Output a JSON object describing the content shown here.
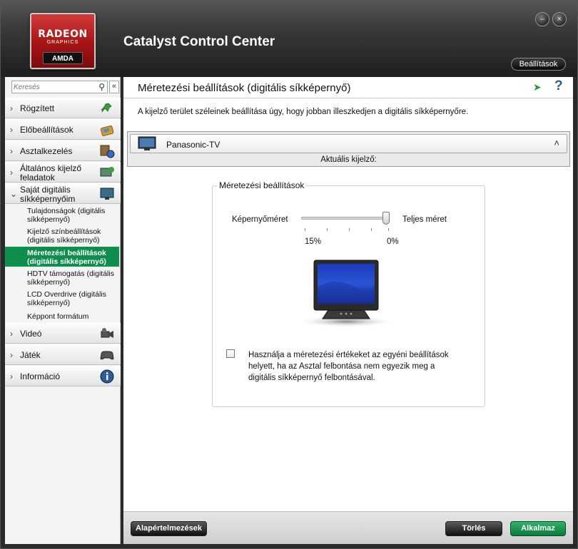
{
  "header": {
    "app_title": "Catalyst Control Center",
    "logo_line1": "RADEON",
    "logo_line2": "GRAPHICS",
    "logo_line3": "AMDA",
    "settings_label": "Beállítások",
    "minimize_glyph": "–",
    "close_glyph": "×"
  },
  "sidebar": {
    "search_placeholder": "Keresés",
    "collapse_glyph": "«",
    "items": [
      {
        "label": "Rögzített",
        "icon": "pin-icon"
      },
      {
        "label": "Előbeállítások",
        "icon": "presets-icon"
      },
      {
        "label": "Asztalkezelés",
        "icon": "desktop-management-icon"
      },
      {
        "label": "Általános kijelző feladatok",
        "icon": "display-tasks-icon"
      },
      {
        "label": "Saját digitális síkképernyőim",
        "icon": "flat-panel-icon"
      },
      {
        "label": "Videó",
        "icon": "video-camera-icon"
      },
      {
        "label": "Játék",
        "icon": "gamepad-icon"
      },
      {
        "label": "Információ",
        "icon": "info-icon"
      }
    ],
    "sub_items": [
      "Tulajdonságok (digitális síkképernyő)",
      "Kijelző színbeállítások (digitális síkképernyő)",
      "Méretezési beállítások (digitális síkképernyő)",
      "HDTV támogatás (digitális síkképernyő)",
      "LCD Overdrive (digitális síkképernyő)",
      "Képpont formátum"
    ]
  },
  "main": {
    "title": "Méretezési beállítások (digitális síkképernyő)",
    "description": "A kijelző terület széleinek beállítása úgy, hogy jobban illeszkedjen a digitális síkképernyőre.",
    "display_name": "Panasonic-TV",
    "current_display_label": "Aktuális kijelző:",
    "group_title": "Méretezési beállítások",
    "slider": {
      "left_label": "Képernyőméret",
      "right_label": "Teljes méret",
      "min_label": "15%",
      "max_label": "0%",
      "value_percent": 0
    },
    "checkbox_label": "Használja a méretezési értékeket az egyéni beállítások helyett, ha az Asztal felbontása nem egyezik meg a digitális síkképernyő felbontásával.",
    "checkbox_checked": false
  },
  "footer": {
    "defaults_label": "Alapértelmezések",
    "cancel_label": "Törlés",
    "apply_label": "Alkalmaz"
  },
  "colors": {
    "accent_green": "#0f8d4d",
    "header_dark": "#1e1e1e",
    "logo_red": "#a51414"
  }
}
